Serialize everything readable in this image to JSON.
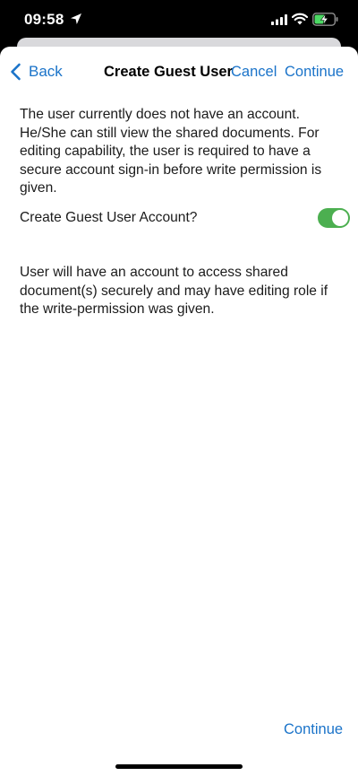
{
  "status_bar": {
    "time": "09:58"
  },
  "nav": {
    "back_label": "Back",
    "title": "Create Guest User",
    "cancel_label": "Cancel",
    "continue_label": "Continue"
  },
  "content": {
    "description": "The user currently does not have an account. He/She can still view the shared documents. For editing capability, the user is required to have a secure account sign-in before write permission is given.",
    "toggle_label": "Create Guest User Account?",
    "toggle_on": true,
    "info": "User will have an account to access shared document(s) securely and may have editing role if the write-permission was given."
  },
  "footer": {
    "continue_label": "Continue"
  },
  "colors": {
    "accent": "#1a73c9",
    "toggle_on": "#4caf50"
  }
}
